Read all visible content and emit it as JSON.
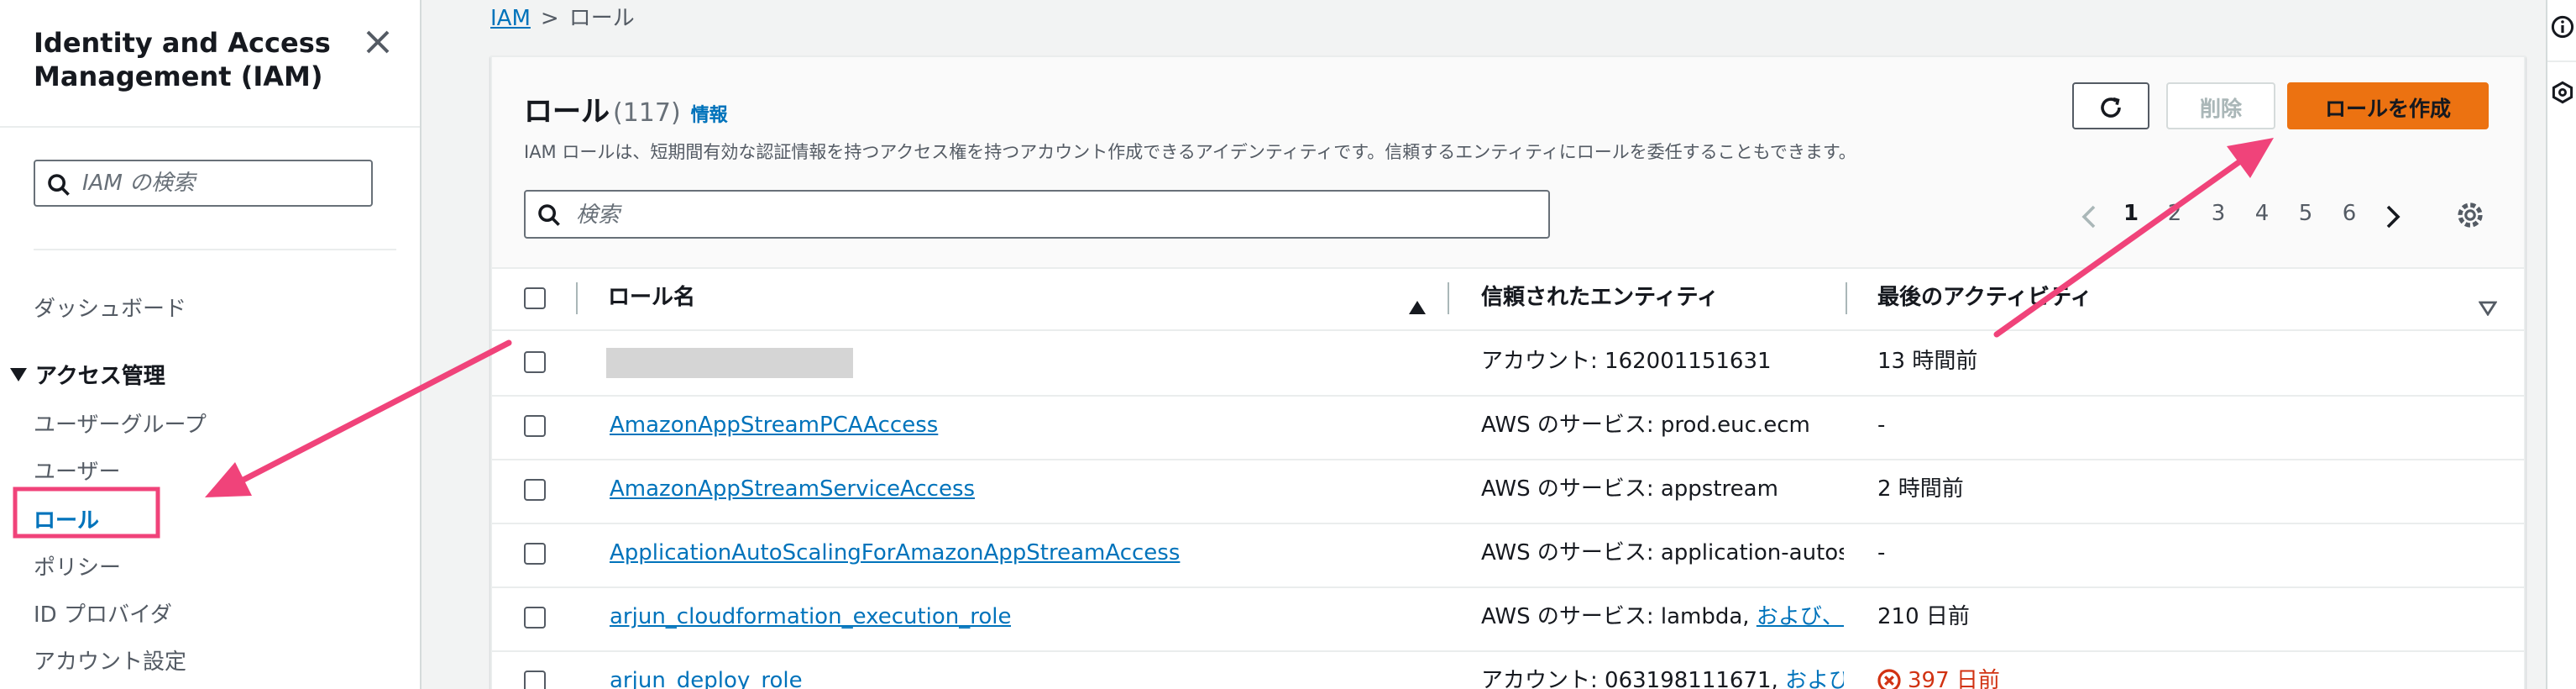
{
  "sidebar": {
    "title": "Identity and Access Management (IAM)",
    "search_placeholder": "IAM の検索",
    "dashboard": "ダッシュボード",
    "section_title": "アクセス管理",
    "items": [
      {
        "label": "ユーザーグループ"
      },
      {
        "label": "ユーザー"
      },
      {
        "label": "ロール"
      },
      {
        "label": "ポリシー"
      },
      {
        "label": "ID プロバイダ"
      },
      {
        "label": "アカウント設定"
      }
    ]
  },
  "breadcrumb": {
    "root": "IAM",
    "separator": ">",
    "current": "ロール"
  },
  "panel": {
    "title": "ロール",
    "count": "(117)",
    "info_link": "情報",
    "description": "IAM ロールは、短期間有効な認証情報を持つアクセス権を持つアカウント作成できるアイデンティティです。信頼するエンティティにロールを委任することもできます。",
    "delete_label": "削除",
    "create_label": "ロールを作成",
    "search_placeholder": "検索"
  },
  "pagination": {
    "pages": [
      "1",
      "2",
      "3",
      "4",
      "5",
      "6"
    ],
    "current": "1"
  },
  "table": {
    "columns": [
      "ロール名",
      "信頼されたエンティティ",
      "最後のアクティビティ"
    ],
    "rows": [
      {
        "name": "",
        "entity": "アカウント: 162001151631",
        "entity_link": "",
        "activity": "13 時間前",
        "activity_warning": false
      },
      {
        "name": "AmazonAppStreamPCAAccess",
        "entity": "AWS のサービス: prod.euc.ecm",
        "entity_link": "",
        "activity": "-",
        "activity_warning": false
      },
      {
        "name": "AmazonAppStreamServiceAccess",
        "entity": "AWS のサービス: appstream",
        "entity_link": "",
        "activity": "2 時間前",
        "activity_warning": false
      },
      {
        "name": "ApplicationAutoScalingForAmazonAppStreamAccess",
        "entity": "AWS のサービス: application-autosca",
        "entity_link": "",
        "activity": "-",
        "activity_warning": false
      },
      {
        "name": "arjun_cloudformation_execution_role",
        "entity": "AWS のサービス: lambda, ",
        "entity_link": "および、さ",
        "activity": "210 日前",
        "activity_warning": false
      },
      {
        "name": "arjun_deploy_role",
        "entity": "アカウント: 063198111671, ",
        "entity_link": "および、",
        "activity": "397 日前",
        "activity_warning": true
      }
    ]
  },
  "colors": {
    "link": "#0073bb",
    "primary_button": "#ec7211",
    "annotation": "#f0437a",
    "warning": "#d13212"
  },
  "icons": [
    "close-icon",
    "search-icon",
    "refresh-icon",
    "chevron-left-icon",
    "chevron-right-icon",
    "gear-icon",
    "sort-asc-icon",
    "filter-icon",
    "warning-icon",
    "info-icon",
    "feedback-icon"
  ]
}
